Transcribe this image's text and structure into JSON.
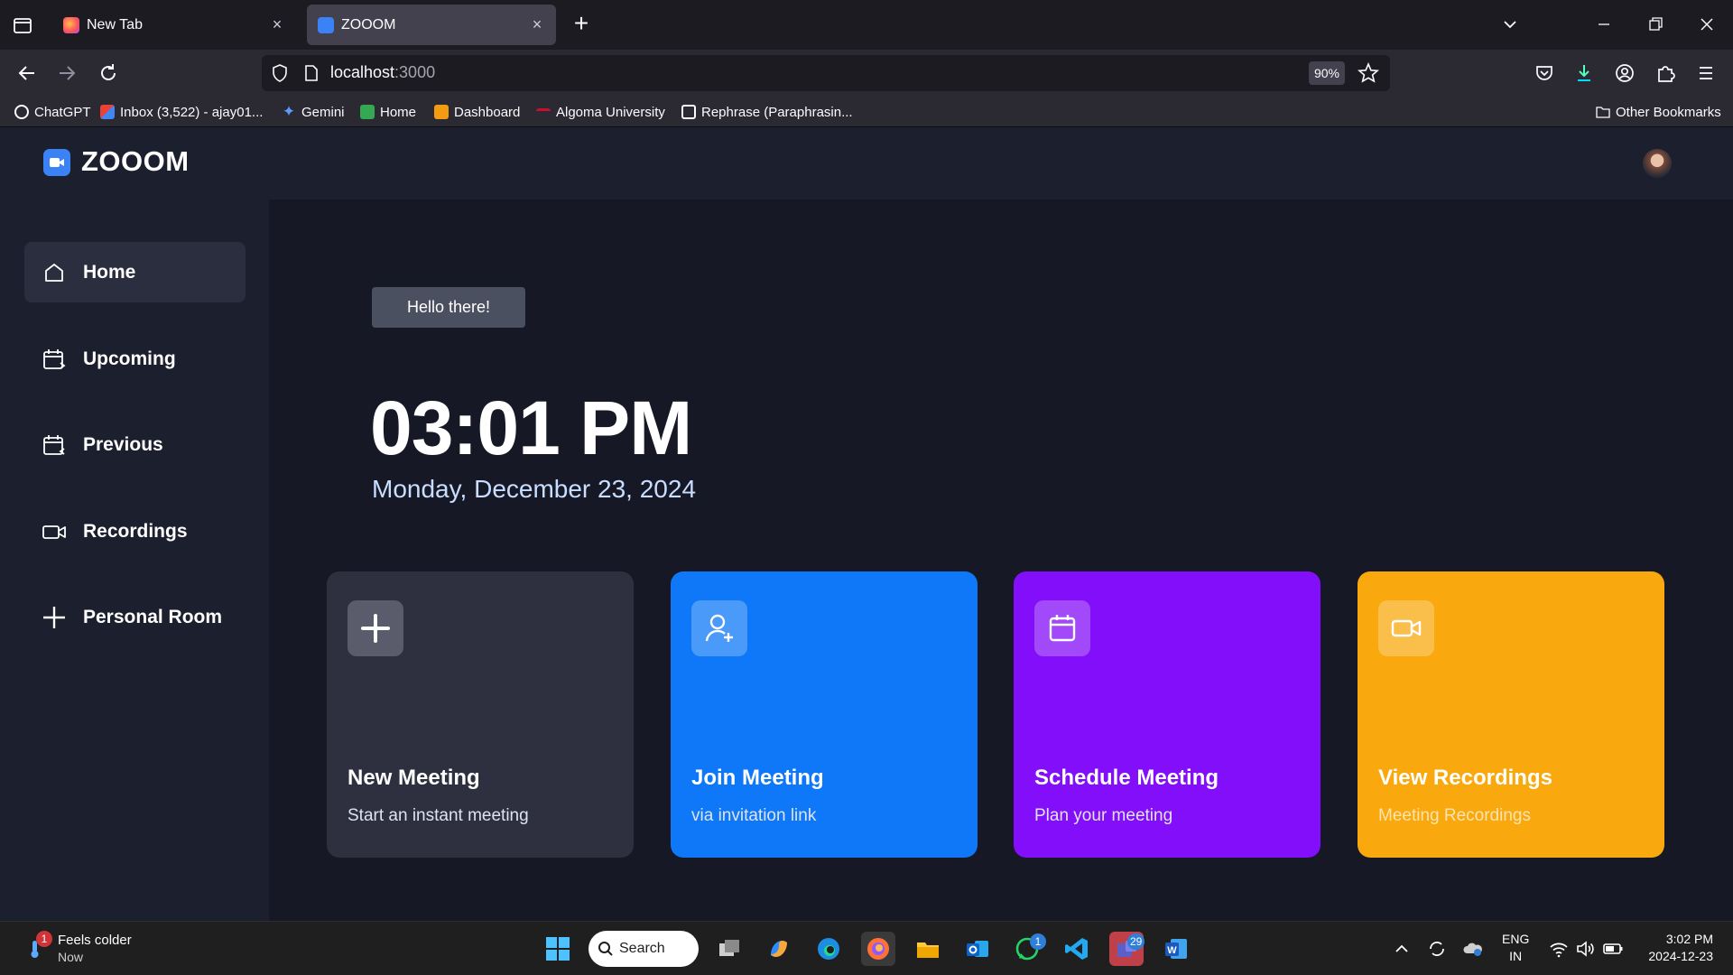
{
  "browser": {
    "tabs": [
      {
        "label": "New Tab"
      },
      {
        "label": "ZOOOM"
      }
    ],
    "url": {
      "host": "localhost",
      "port": ":3000"
    },
    "zoom": "90%",
    "bookmarks": [
      {
        "label": "ChatGPT"
      },
      {
        "label": "Inbox (3,522) - ajay01..."
      },
      {
        "label": "Gemini"
      },
      {
        "label": "Home"
      },
      {
        "label": "Dashboard"
      },
      {
        "label": "Algoma University"
      },
      {
        "label": "Rephrase (Paraphrasin..."
      }
    ],
    "other_bookmarks": "Other Bookmarks"
  },
  "app": {
    "name": "ZOOOM",
    "sidebar": [
      {
        "label": "Home",
        "icon": "home-icon",
        "active": true
      },
      {
        "label": "Upcoming",
        "icon": "calendar-upcoming-icon"
      },
      {
        "label": "Previous",
        "icon": "calendar-previous-icon"
      },
      {
        "label": "Recordings",
        "icon": "video-icon"
      },
      {
        "label": "Personal Room",
        "icon": "plus-icon"
      }
    ],
    "greeting": "Hello there!",
    "time": "03:01 PM",
    "date": "Monday, December 23, 2024",
    "cards": [
      {
        "title": "New Meeting",
        "subtitle": "Start an instant meeting",
        "icon": "plus-icon",
        "color": "#2e3040"
      },
      {
        "title": "Join Meeting",
        "subtitle": "via invitation link",
        "icon": "user-plus-icon",
        "color": "#0e78f9"
      },
      {
        "title": "Schedule Meeting",
        "subtitle": "Plan your meeting",
        "icon": "calendar-icon",
        "color": "#830ef9"
      },
      {
        "title": "View Recordings",
        "subtitle": "Meeting Recordings",
        "icon": "video-icon",
        "color": "#f9a90e"
      }
    ]
  },
  "taskbar": {
    "weather_badge": "1",
    "weather_title": "Feels colder",
    "weather_time": "Now",
    "search": "Search",
    "whatsapp_badge": "1",
    "teams_badge": "29",
    "lang_1": "ENG",
    "lang_2": "IN",
    "clock_time": "3:02 PM",
    "clock_date": "2024-12-23"
  }
}
